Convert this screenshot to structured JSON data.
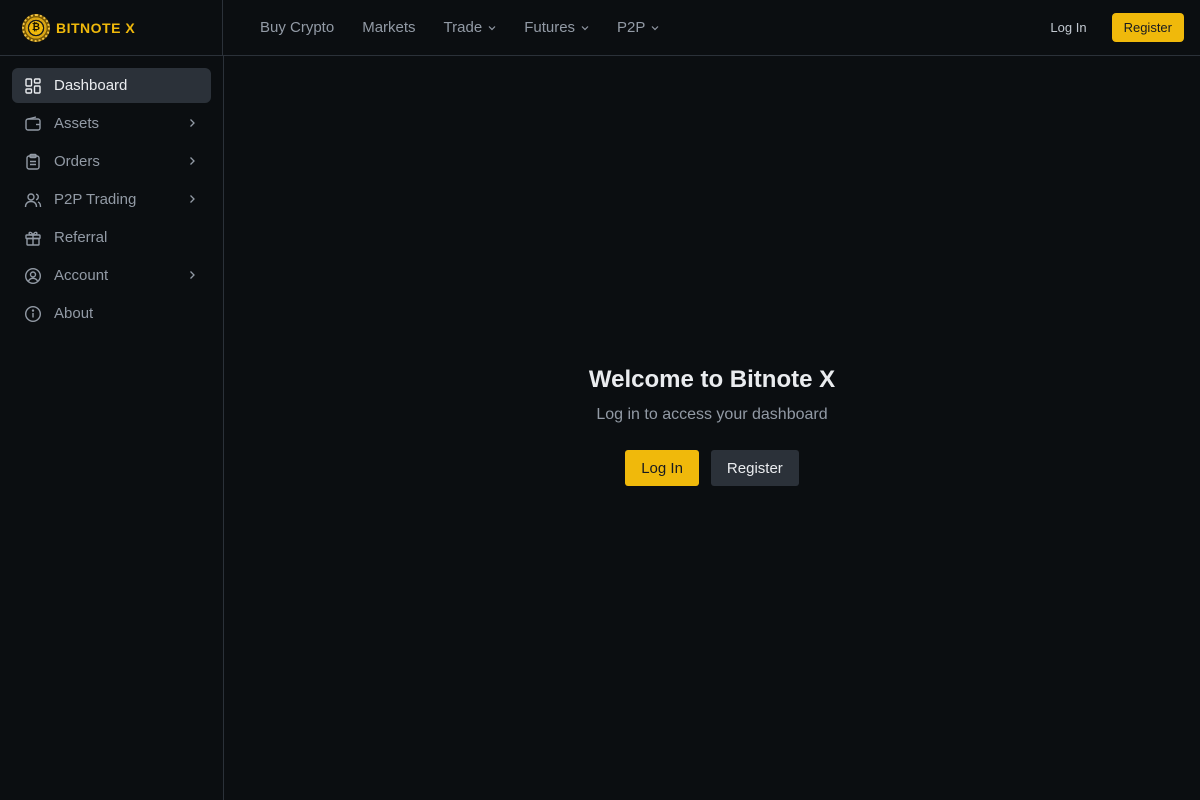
{
  "brand": {
    "name": "BITNOTE X",
    "logo_symbol": "₿",
    "accent": "#f0b90b"
  },
  "header": {
    "nav": [
      {
        "label": "Buy Crypto",
        "has_dropdown": false
      },
      {
        "label": "Markets",
        "has_dropdown": false
      },
      {
        "label": "Trade",
        "has_dropdown": true
      },
      {
        "label": "Futures",
        "has_dropdown": true
      },
      {
        "label": "P2P",
        "has_dropdown": true
      }
    ],
    "login_label": "Log In",
    "register_label": "Register"
  },
  "sidebar": {
    "items": [
      {
        "label": "Dashboard",
        "icon": "dashboard-icon",
        "active": true,
        "expandable": false
      },
      {
        "label": "Assets",
        "icon": "wallet-icon",
        "active": false,
        "expandable": true
      },
      {
        "label": "Orders",
        "icon": "clipboard-icon",
        "active": false,
        "expandable": true
      },
      {
        "label": "P2P Trading",
        "icon": "users-icon",
        "active": false,
        "expandable": true
      },
      {
        "label": "Referral",
        "icon": "gift-icon",
        "active": false,
        "expandable": false
      },
      {
        "label": "Account",
        "icon": "user-circle-icon",
        "active": false,
        "expandable": true
      },
      {
        "label": "About",
        "icon": "info-icon",
        "active": false,
        "expandable": false
      }
    ]
  },
  "main": {
    "title": "Welcome to Bitnote X",
    "subtitle": "Log in to access your dashboard",
    "login_label": "Log In",
    "register_label": "Register"
  },
  "colors": {
    "background": "#0b0e11",
    "border": "#2b3139",
    "accent": "#f0b90b",
    "text_primary": "#eaecef",
    "text_secondary": "#929aa5"
  }
}
